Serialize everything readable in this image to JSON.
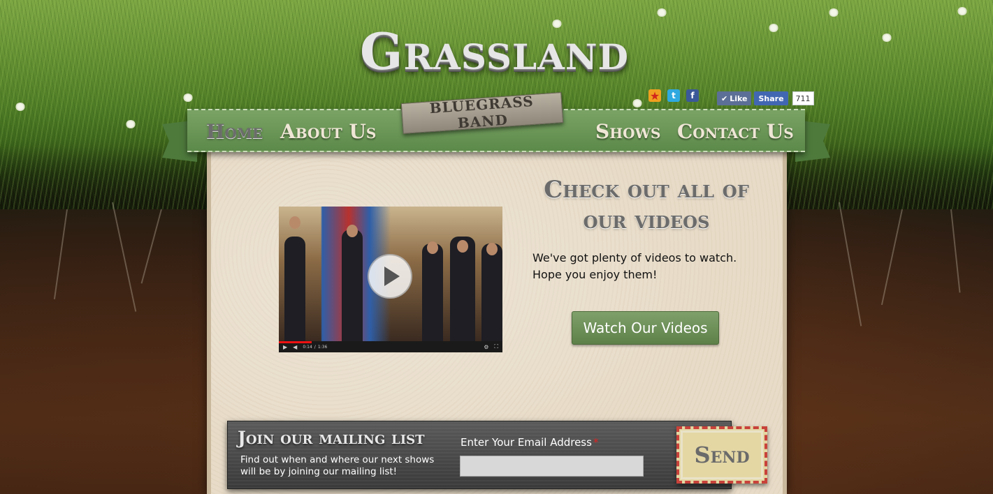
{
  "logo": {
    "main": "Grassland",
    "ribbon": "BLUEGRASS BAND"
  },
  "nav": {
    "items": [
      {
        "label": "Home",
        "active": true
      },
      {
        "label": "About Us",
        "active": false
      },
      {
        "label": "Shows",
        "active": false
      },
      {
        "label": "Contact Us",
        "active": false
      }
    ]
  },
  "social": {
    "icons": [
      "bookmark-star-icon",
      "twitter-icon",
      "facebook-icon"
    ],
    "like_label": "Like",
    "share_label": "Share",
    "like_count": "711"
  },
  "video": {
    "time": "0:14",
    "duration": "1:36"
  },
  "feature": {
    "headline": "Check out all of our videos",
    "description": "We've got plenty of videos to watch. Hope you enjoy them!",
    "button_label": "Watch Our Videos"
  },
  "mailing": {
    "title": "Join our mailing list",
    "description": "Find out when and where our next shows will be by joining our mailing list!",
    "email_label": "Enter Your Email Address",
    "required_marker": "*",
    "email_value": "",
    "send_label": "Send"
  },
  "colors": {
    "nav_green": "#6a9456",
    "paper": "#e8dcc8",
    "button_green": "#6e9259",
    "send_border": "#c8423a"
  }
}
